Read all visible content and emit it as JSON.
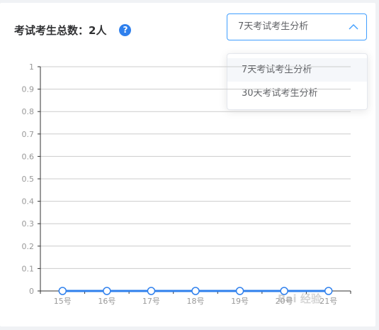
{
  "header": {
    "title": "考试考生总数：2人",
    "help_icon": "?"
  },
  "select": {
    "value": "7天考试考生分析",
    "options": [
      "7天考试考生分析",
      "30天考试考生分析"
    ],
    "open": true
  },
  "watermark": "Bai 经验",
  "colors": {
    "accent": "#409eff",
    "series": "#2f80ed",
    "help": "#2f80ed"
  },
  "chart_data": {
    "type": "line",
    "categories": [
      "15号",
      "16号",
      "17号",
      "18号",
      "19号",
      "20号",
      "21号"
    ],
    "values": [
      0,
      0,
      0,
      0,
      0,
      0,
      0
    ],
    "yticks": [
      "0",
      "0.1",
      "0.2",
      "0.3",
      "0.4",
      "0.5",
      "0.6",
      "0.7",
      "0.8",
      "0.9",
      "1"
    ],
    "ylim": [
      0,
      1
    ],
    "grid": true
  }
}
